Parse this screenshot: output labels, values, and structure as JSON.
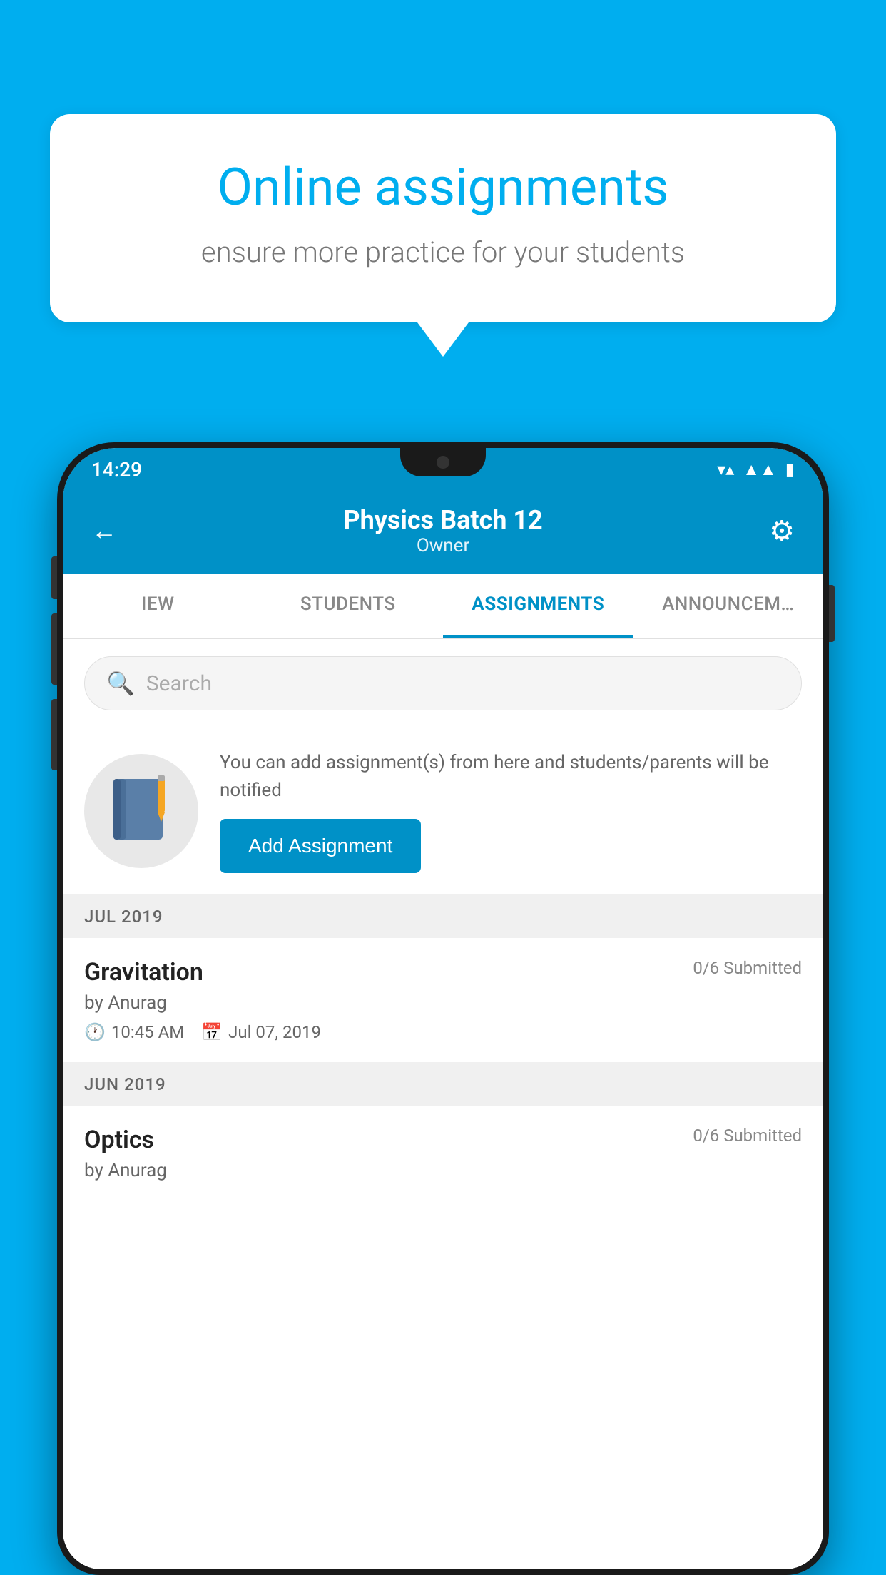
{
  "background_color": "#00AEEF",
  "bubble": {
    "title": "Online assignments",
    "subtitle": "ensure more practice for your students"
  },
  "status_bar": {
    "time": "14:29",
    "icons": [
      "wifi",
      "signal",
      "battery"
    ]
  },
  "header": {
    "title": "Physics Batch 12",
    "subtitle": "Owner",
    "back_label": "←",
    "settings_label": "⚙"
  },
  "tabs": [
    {
      "label": "IEW",
      "active": false
    },
    {
      "label": "STUDENTS",
      "active": false
    },
    {
      "label": "ASSIGNMENTS",
      "active": true
    },
    {
      "label": "ANNOUNCEM…",
      "active": false
    }
  ],
  "search": {
    "placeholder": "Search"
  },
  "promo": {
    "description": "You can add assignment(s) from here and students/parents will be notified",
    "button_label": "Add Assignment"
  },
  "sections": [
    {
      "header": "JUL 2019",
      "items": [
        {
          "title": "Gravitation",
          "submitted": "0/6 Submitted",
          "by": "by Anurag",
          "time": "10:45 AM",
          "date": "Jul 07, 2019"
        }
      ]
    },
    {
      "header": "JUN 2019",
      "items": [
        {
          "title": "Optics",
          "submitted": "0/6 Submitted",
          "by": "by Anurag",
          "time": "",
          "date": ""
        }
      ]
    }
  ]
}
